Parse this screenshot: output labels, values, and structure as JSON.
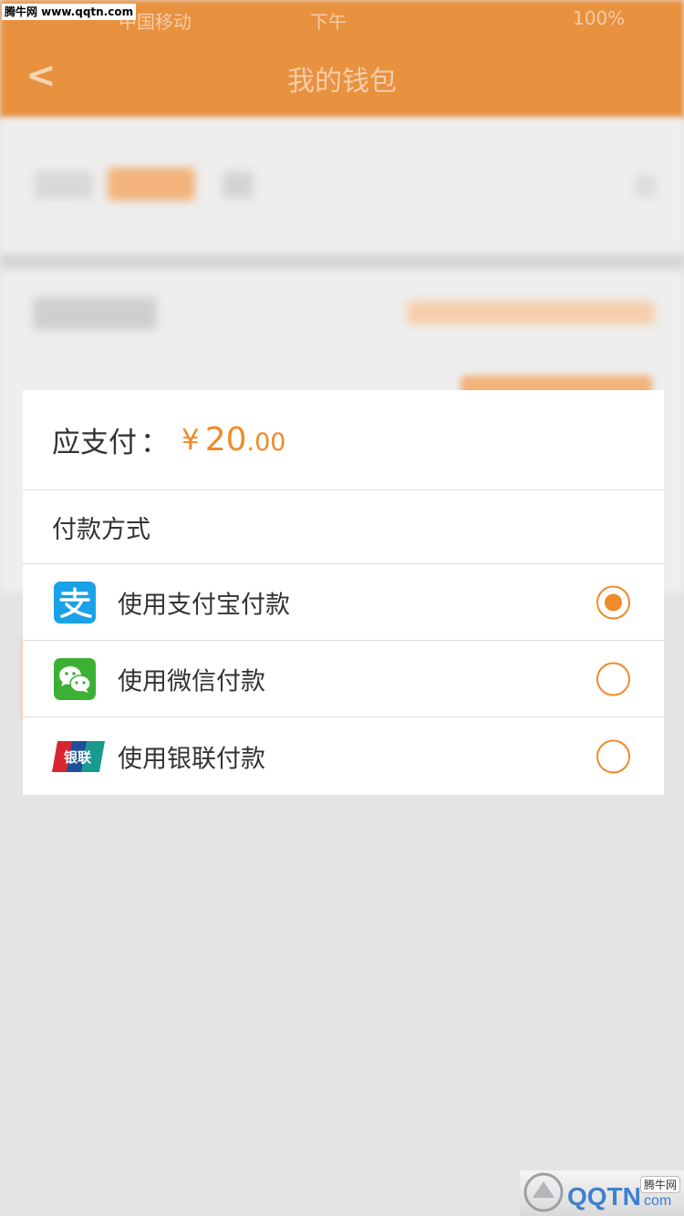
{
  "status_bar": {
    "left": "中国移动",
    "time": "下午",
    "battery": "100%"
  },
  "background_page": {
    "title": "我的钱包",
    "back": "<"
  },
  "watermark": {
    "top": "腾牛网 www.qqtn.com",
    "bottom_tag": "腾牛网",
    "bottom_logo": "QQTN.com"
  },
  "payment_sheet": {
    "amount_label": "应支付",
    "amount_colon": "：",
    "currency": "¥",
    "amount_integer": "20",
    "amount_decimal": ".00",
    "method_title": "付款方式",
    "methods": [
      {
        "label": "使用支付宝付款",
        "icon": "alipay-icon",
        "selected": true
      },
      {
        "label": "使用微信付款",
        "icon": "wechat-icon",
        "selected": false
      },
      {
        "label": "使用银联付款",
        "icon": "unionpay-icon",
        "selected": false
      }
    ]
  },
  "colors": {
    "accent": "#f08a2a",
    "header_bg": "#e8913f",
    "alipay": "#1aa1e8",
    "wechat": "#3cb034",
    "unionpay_red": "#d9252f",
    "unionpay_blue": "#1e4f9c",
    "unionpay_green": "#1a9a8f"
  }
}
